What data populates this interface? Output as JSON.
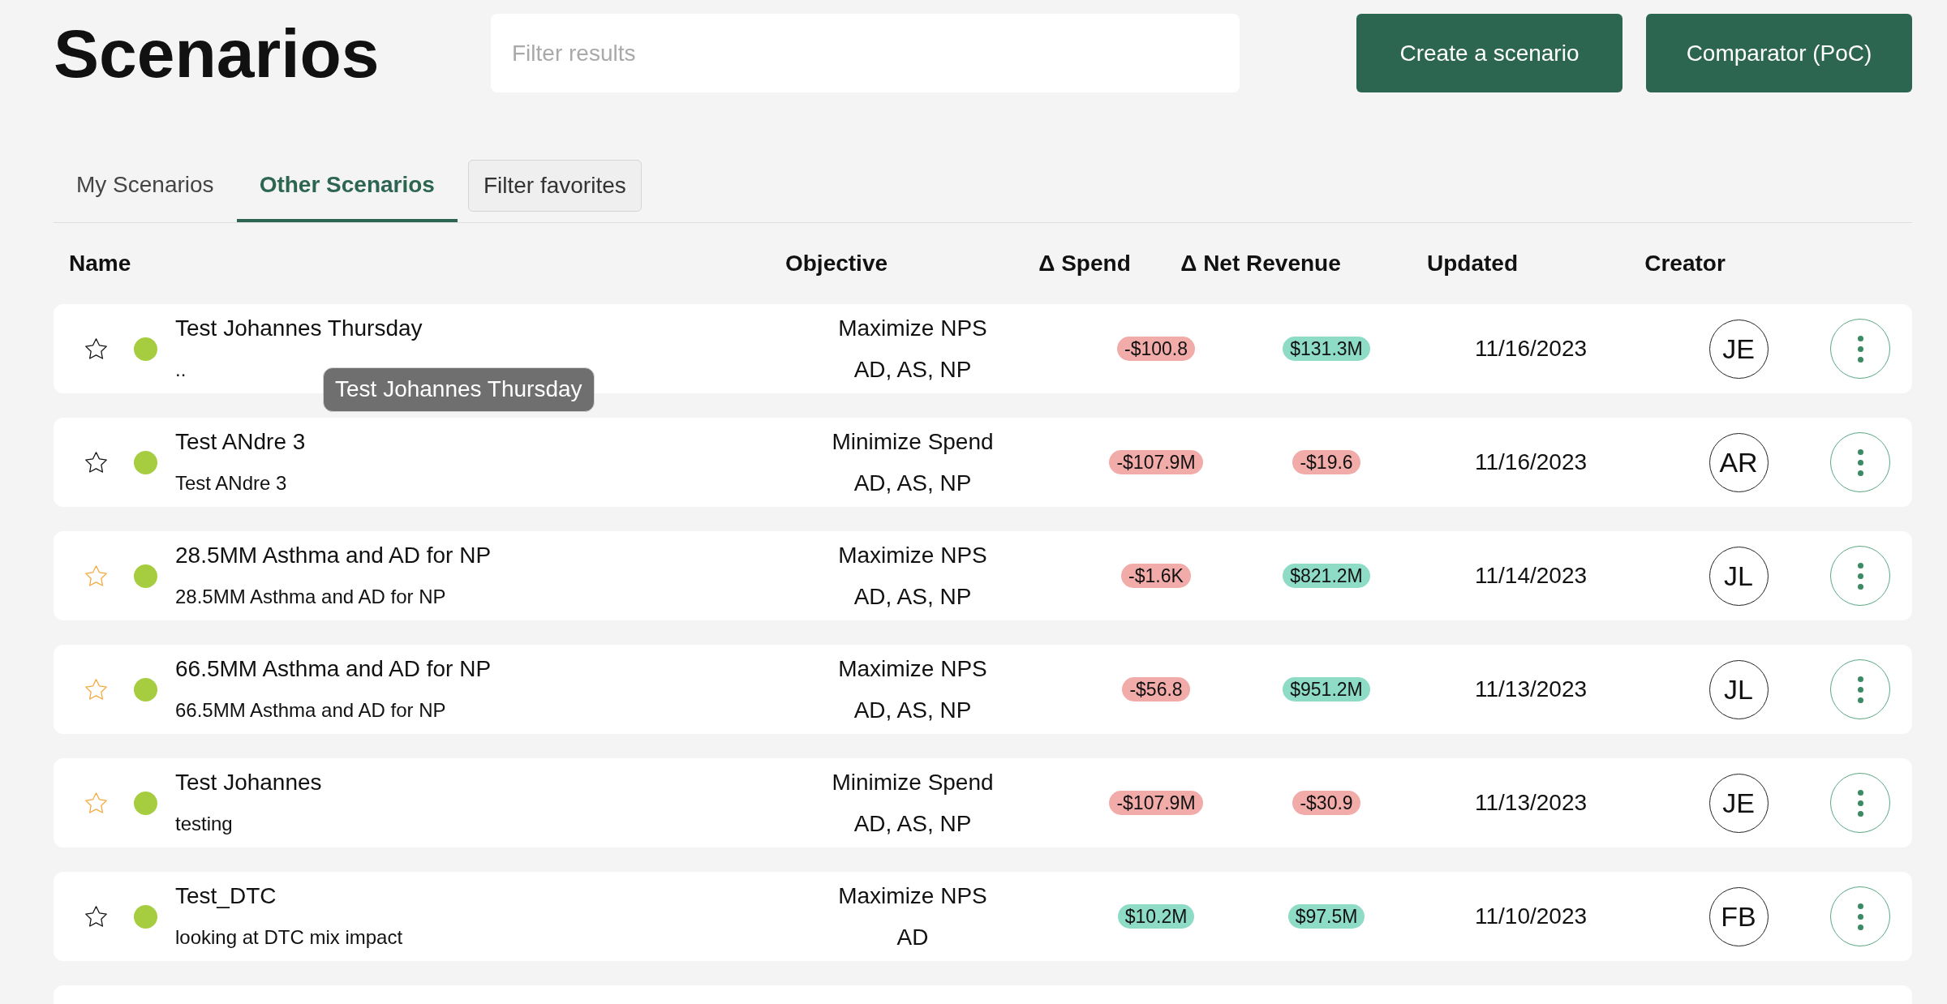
{
  "page": {
    "title": "Scenarios"
  },
  "filter": {
    "placeholder": "Filter results"
  },
  "actions": [
    {
      "label": "Create a scenario"
    },
    {
      "label": "Comparator (PoC)"
    }
  ],
  "tabs": [
    {
      "label": "My Scenarios",
      "selected": false
    },
    {
      "label": "Other Scenarios",
      "selected": true
    }
  ],
  "filter_favorites": {
    "label": "Filter favorites"
  },
  "table": {
    "columns": [
      "Name",
      "Objective",
      "Δ Spend",
      "Δ Net Revenue",
      "Updated",
      "Creator"
    ],
    "rows": [
      {
        "favorite": false,
        "color": "#a6cd3f",
        "name": "Test Johannes Thursday",
        "description": "..",
        "objective": "Maximize NPS",
        "products": "AD, AS, NP",
        "spend": {
          "text": "-$100.8",
          "color": "#f1aba9"
        },
        "net_revenue": {
          "text": "$131.3M",
          "color": "#8edcc6"
        },
        "updated": "11/16/2023",
        "creator": "JE",
        "tooltip": "Test Johannes Thursday"
      },
      {
        "favorite": false,
        "color": "#a6cd3f",
        "name": "Test ANdre 3",
        "description": "Test ANdre 3",
        "objective": "Minimize Spend",
        "products": "AD, AS, NP",
        "spend": {
          "text": "-$107.9M",
          "color": "#f1aba9"
        },
        "net_revenue": {
          "text": "-$19.6",
          "color": "#f1aba9"
        },
        "updated": "11/16/2023",
        "creator": "AR"
      },
      {
        "favorite": true,
        "color": "#a6cd3f",
        "name": "28.5MM Asthma and AD for NP",
        "description": "28.5MM Asthma and AD for NP",
        "objective": "Maximize NPS",
        "products": "AD, AS, NP",
        "spend": {
          "text": "-$1.6K",
          "color": "#f1aba9"
        },
        "net_revenue": {
          "text": "$821.2M",
          "color": "#8edcc6"
        },
        "updated": "11/14/2023",
        "creator": "JL"
      },
      {
        "favorite": true,
        "color": "#a6cd3f",
        "name": "66.5MM Asthma and AD for NP",
        "description": "66.5MM Asthma and AD for NP",
        "objective": "Maximize NPS",
        "products": "AD, AS, NP",
        "spend": {
          "text": "-$56.8",
          "color": "#f1aba9"
        },
        "net_revenue": {
          "text": "$951.2M",
          "color": "#8edcc6"
        },
        "updated": "11/13/2023",
        "creator": "JL"
      },
      {
        "favorite": true,
        "color": "#a6cd3f",
        "name": "Test Johannes",
        "description": "testing",
        "objective": "Minimize Spend",
        "products": "AD, AS, NP",
        "spend": {
          "text": "-$107.9M",
          "color": "#f1aba9"
        },
        "net_revenue": {
          "text": "-$30.9",
          "color": "#f1aba9"
        },
        "updated": "11/13/2023",
        "creator": "JE"
      },
      {
        "favorite": false,
        "color": "#a6cd3f",
        "name": "Test_DTC",
        "description": "looking at DTC mix impact",
        "objective": "Maximize NPS",
        "products": "AD",
        "spend": {
          "text": "$10.2M",
          "color": "#8edcc6"
        },
        "net_revenue": {
          "text": "$97.5M",
          "color": "#8edcc6"
        },
        "updated": "11/10/2023",
        "creator": "FB"
      }
    ],
    "rows_continue_below": true
  }
}
